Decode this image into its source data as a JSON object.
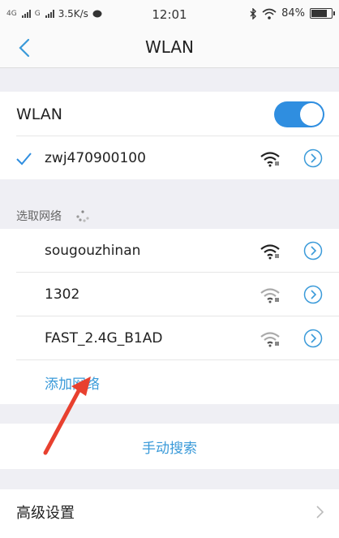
{
  "status_bar": {
    "network1": "4G",
    "network2": "G",
    "speed": "3.5K/s",
    "time": "12:01",
    "battery": "84%",
    "battery_level": 0.84
  },
  "nav": {
    "title": "WLAN"
  },
  "wlan": {
    "label": "WLAN",
    "enabled": true
  },
  "connected": {
    "name": "zwj470900100",
    "signal": "full"
  },
  "choose_label": "选取网络",
  "networks": [
    {
      "name": "sougouzhinan",
      "signal": "full"
    },
    {
      "name": "1302",
      "signal": "weak"
    },
    {
      "name": "FAST_2.4G_B1AD",
      "signal": "weak"
    }
  ],
  "add_network": "添加网络",
  "manual_search": "手动搜索",
  "advanced": "高级设置",
  "colors": {
    "accent": "#2f8ee0",
    "link": "#3a9ad9",
    "background": "#efeff4",
    "arrow": "#e8402f"
  }
}
